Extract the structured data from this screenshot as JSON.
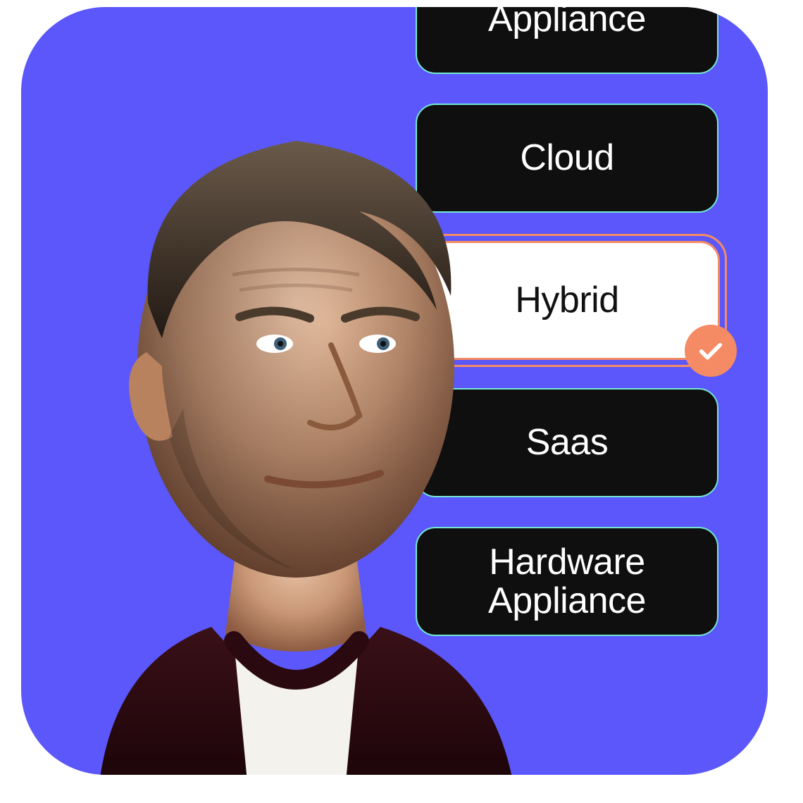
{
  "colors": {
    "background": "#5B57FA",
    "option_bg_dark": "#0f0f0f",
    "option_text_dark": "#ffffff",
    "option_selected_bg": "#ffffff",
    "option_selected_text": "#111111",
    "accent_orange": "#F58B65",
    "accent_mint": "#74E7D3",
    "check_fg": "#ffffff"
  },
  "options": [
    {
      "label": "Appliance",
      "selected": false
    },
    {
      "label": "Cloud",
      "selected": false
    },
    {
      "label": "Hybrid",
      "selected": true
    },
    {
      "label": "Saas",
      "selected": false
    },
    {
      "label": "Hardware Appliance",
      "selected": false
    }
  ],
  "icons": {
    "check": "check-icon"
  }
}
